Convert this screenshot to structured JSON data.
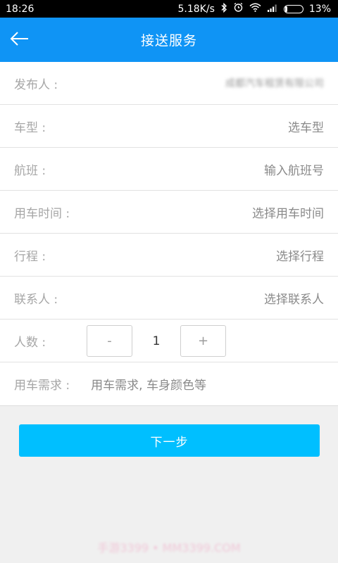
{
  "status_bar": {
    "time": "18:26",
    "net_speed": "5.18K/s",
    "battery_percent": "13%",
    "battery_level": 0.13,
    "icons": [
      "bluetooth-icon",
      "alarm-icon",
      "wifi-icon",
      "signal-icon",
      "battery-icon"
    ]
  },
  "header": {
    "title": "接送服务",
    "back_icon": "back-arrow-icon",
    "color": "#0f94f5"
  },
  "form": {
    "publisher": {
      "label": "发布人 :",
      "value": "成都汽车租赁有限公司"
    },
    "car_type": {
      "label": "车型 :",
      "value": "选车型"
    },
    "flight": {
      "label": "航班 :",
      "value": "输入航班号"
    },
    "use_time": {
      "label": "用车时间 :",
      "value": "选择用车时间"
    },
    "itinerary": {
      "label": "行程 :",
      "value": "选择行程"
    },
    "contact": {
      "label": "联系人 :",
      "value": "选择联系人"
    },
    "people": {
      "label": "人数 :",
      "minus": "-",
      "count": "1",
      "plus": "+"
    },
    "demand": {
      "label": "用车需求 :",
      "placeholder": "用车需求, 车身颜色等"
    }
  },
  "next_button": {
    "label": "下一步",
    "color": "#00bfff"
  },
  "watermark": {
    "text": "手游3399 • MM3399.COM"
  }
}
